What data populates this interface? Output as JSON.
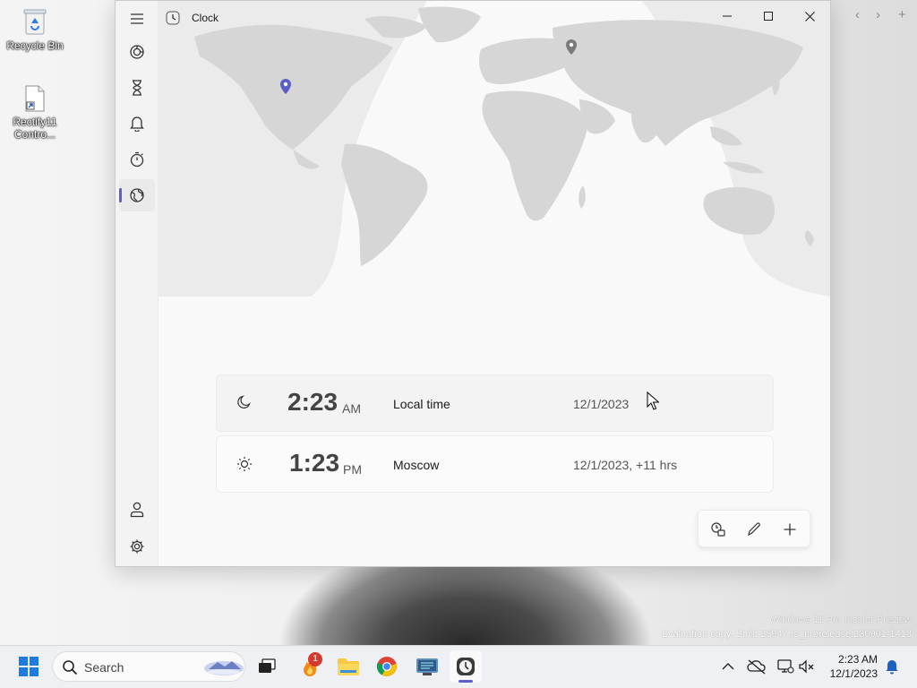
{
  "desktop": {
    "icons": [
      {
        "label": "Recycle Bin"
      },
      {
        "label": "Rectify11 Contro..."
      }
    ],
    "watermark": {
      "line1": "Windows 11 Pro Insider Preview",
      "line2": "Evaluation copy. Build 25947.rs_prerelease.230901-1418"
    }
  },
  "window": {
    "title": "Clock",
    "nav": [
      {
        "name": "focus-sessions",
        "icon": "focus-icon"
      },
      {
        "name": "timer",
        "icon": "hourglass-icon"
      },
      {
        "name": "alarm",
        "icon": "bell-icon"
      },
      {
        "name": "stopwatch",
        "icon": "stopwatch-icon"
      },
      {
        "name": "world-clock",
        "icon": "globe-icon",
        "selected": true
      }
    ],
    "nav_bottom": [
      {
        "name": "account",
        "icon": "person-icon"
      },
      {
        "name": "settings",
        "icon": "gear-icon"
      }
    ],
    "clocks": [
      {
        "time": "2:23",
        "ampm": "AM",
        "city": "Local time",
        "date": "12/1/2023",
        "phase": "moon-icon"
      },
      {
        "time": "1:23",
        "ampm": "PM",
        "city": "Moscow",
        "date": "12/1/2023, +11 hrs",
        "phase": "sun-icon"
      }
    ],
    "accent": "#5b5fc7"
  },
  "taskbar": {
    "search_label": "Search",
    "notification_count": "1",
    "time": "2:23 AM",
    "date": "12/1/2023"
  }
}
